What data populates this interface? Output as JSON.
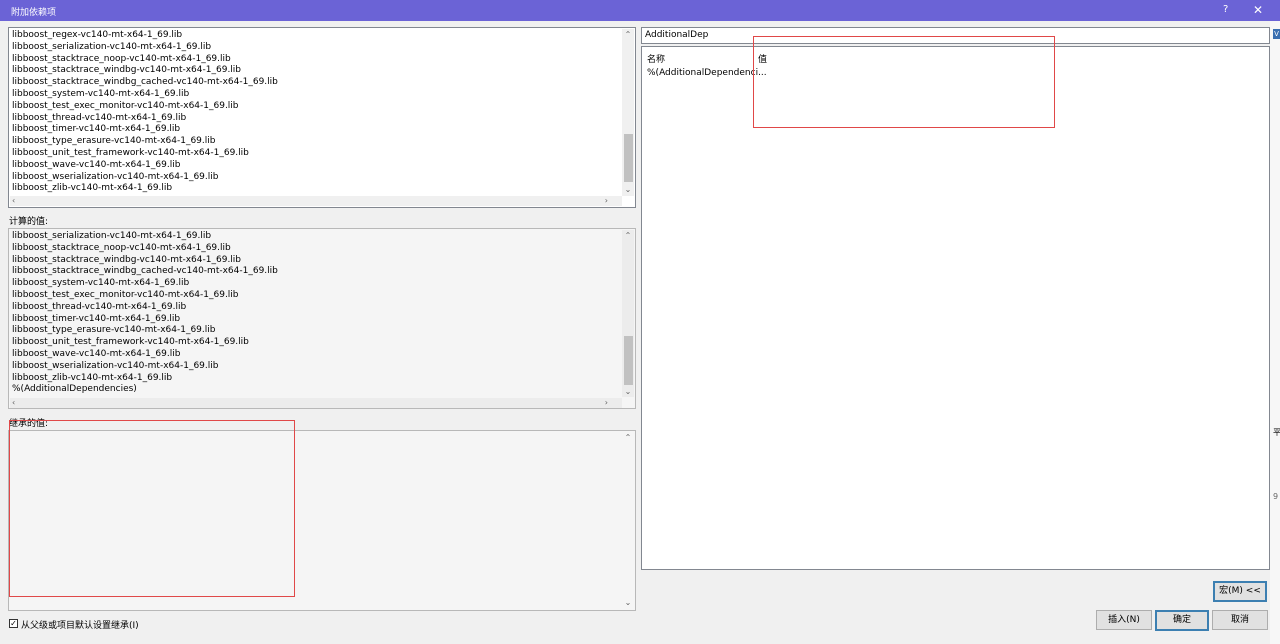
{
  "window": {
    "title": "附加依赖项",
    "help": "?",
    "close": "✕"
  },
  "input_list": {
    "items": [
      "libboost_regex-vc140-mt-x64-1_69.lib",
      "libboost_serialization-vc140-mt-x64-1_69.lib",
      "libboost_stacktrace_noop-vc140-mt-x64-1_69.lib",
      "libboost_stacktrace_windbg-vc140-mt-x64-1_69.lib",
      "libboost_stacktrace_windbg_cached-vc140-mt-x64-1_69.lib",
      "libboost_system-vc140-mt-x64-1_69.lib",
      "libboost_test_exec_monitor-vc140-mt-x64-1_69.lib",
      "libboost_thread-vc140-mt-x64-1_69.lib",
      "libboost_timer-vc140-mt-x64-1_69.lib",
      "libboost_type_erasure-vc140-mt-x64-1_69.lib",
      "libboost_unit_test_framework-vc140-mt-x64-1_69.lib",
      "libboost_wave-vc140-mt-x64-1_69.lib",
      "libboost_wserialization-vc140-mt-x64-1_69.lib",
      "libboost_zlib-vc140-mt-x64-1_69.lib"
    ]
  },
  "evaluated": {
    "label": "计算的值:",
    "items": [
      "libboost_serialization-vc140-mt-x64-1_69.lib",
      "libboost_stacktrace_noop-vc140-mt-x64-1_69.lib",
      "libboost_stacktrace_windbg-vc140-mt-x64-1_69.lib",
      "libboost_stacktrace_windbg_cached-vc140-mt-x64-1_69.lib",
      "libboost_system-vc140-mt-x64-1_69.lib",
      "libboost_test_exec_monitor-vc140-mt-x64-1_69.lib",
      "libboost_thread-vc140-mt-x64-1_69.lib",
      "libboost_timer-vc140-mt-x64-1_69.lib",
      "libboost_type_erasure-vc140-mt-x64-1_69.lib",
      "libboost_unit_test_framework-vc140-mt-x64-1_69.lib",
      "libboost_wave-vc140-mt-x64-1_69.lib",
      "libboost_wserialization-vc140-mt-x64-1_69.lib",
      "libboost_zlib-vc140-mt-x64-1_69.lib",
      "%(AdditionalDependencies)"
    ]
  },
  "inherited": {
    "label": "继承的值:"
  },
  "inherit_checkbox": {
    "label": "从父级或项目默认设置继承(I)",
    "checked": true
  },
  "macros": {
    "search_value": "AdditionalDep",
    "col_name": "名称",
    "col_value": "值",
    "rows": [
      {
        "name": "%(AdditionalDependenci...",
        "value": ""
      }
    ]
  },
  "buttons": {
    "macro": "宏(M) <<",
    "insert": "插入(N)",
    "ok": "确定",
    "cancel": "取消"
  },
  "edge_text": {
    "right_v": "V",
    "right_9": "9",
    "right_top": "1",
    "right_mid": "平"
  }
}
